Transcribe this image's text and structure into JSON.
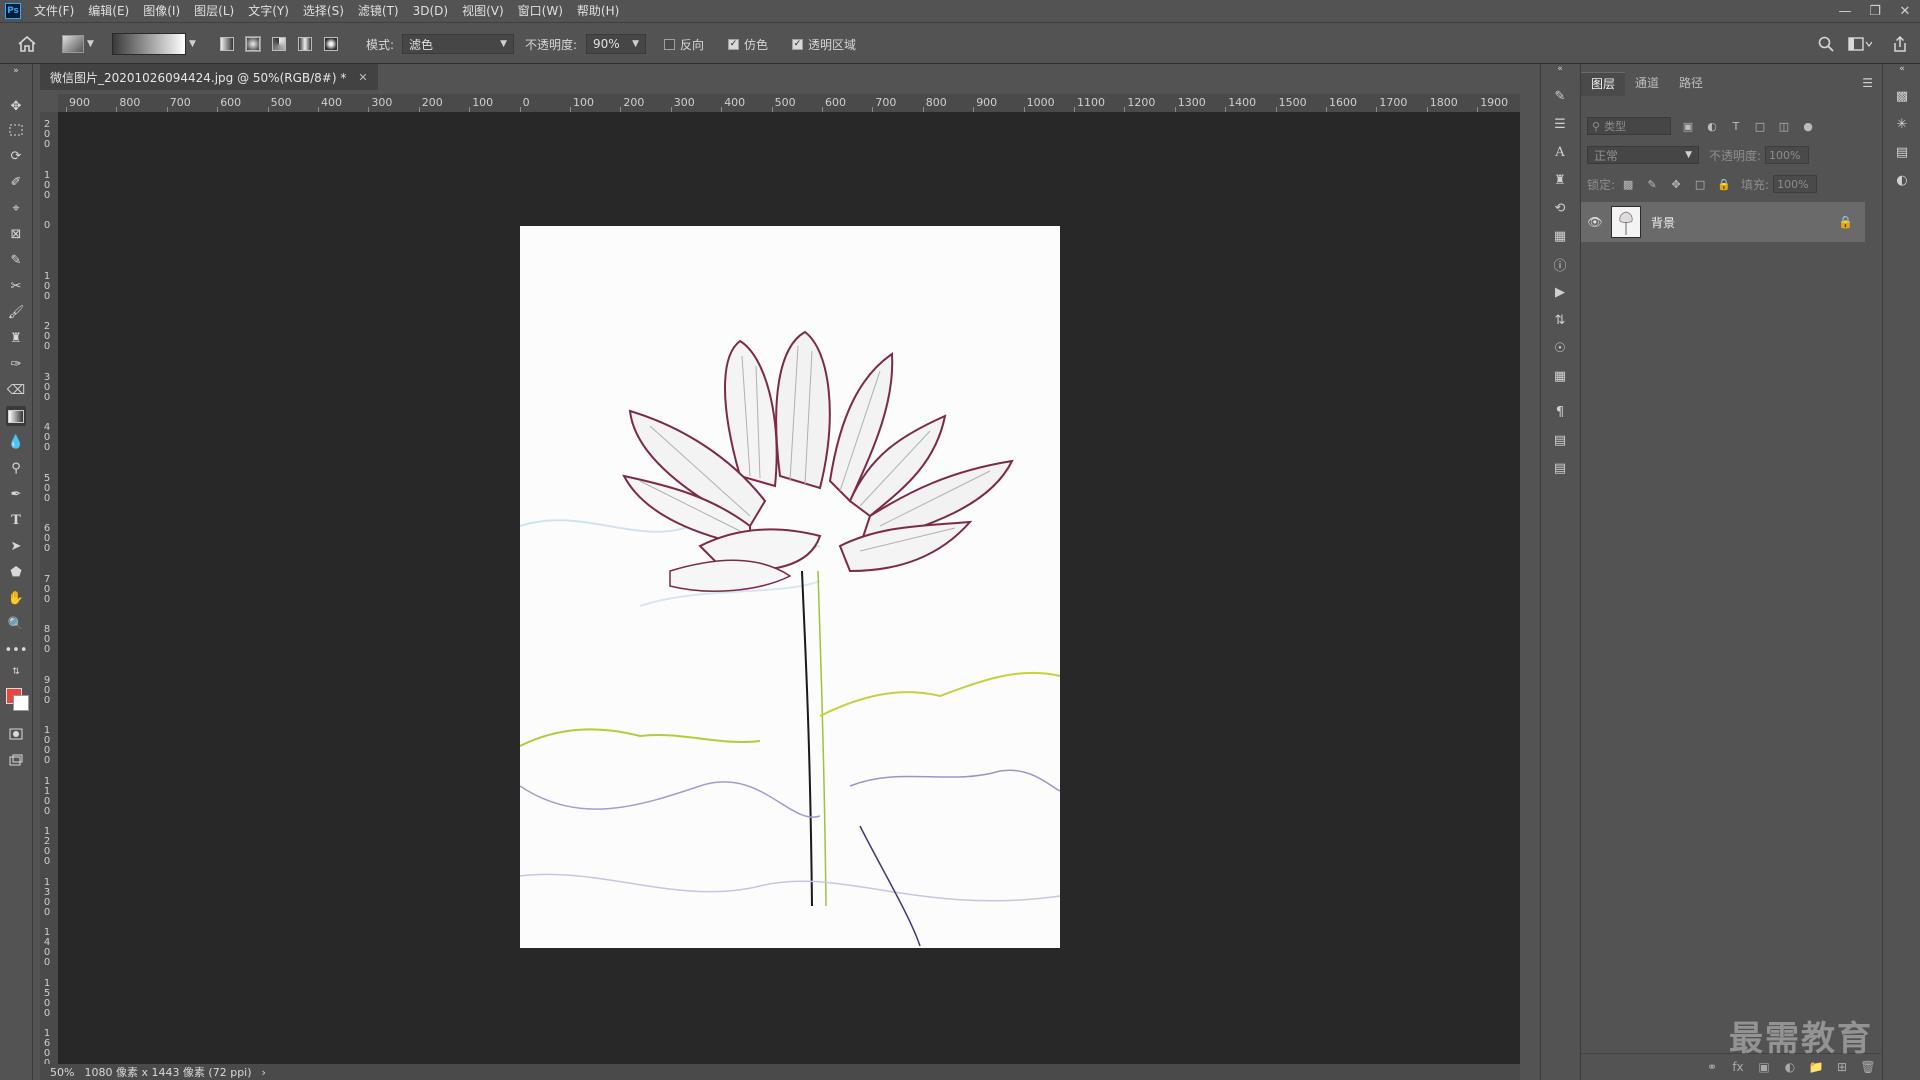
{
  "menu": {
    "logo": "Ps",
    "items": [
      "文件(F)",
      "编辑(E)",
      "图像(I)",
      "图层(L)",
      "文字(Y)",
      "选择(S)",
      "滤镜(T)",
      "3D(D)",
      "视图(V)",
      "窗口(W)",
      "帮助(H)"
    ]
  },
  "options": {
    "mode_label": "模式:",
    "mode_value": "滤色",
    "opacity_label": "不透明度:",
    "opacity_value": "90%",
    "reverse_label": "反向",
    "dither_label": "仿色",
    "transparency_label": "透明区域",
    "reverse_checked": false,
    "dither_checked": true,
    "transparency_checked": true
  },
  "document": {
    "tab_title": "微信图片_20201026094424.jpg @ 50%(RGB/8#) *",
    "zoom": "50%",
    "info": "1080 像素 x 1443 像素 (72 ppi)"
  },
  "ruler": {
    "top_labels": [
      "900",
      "800",
      "700",
      "600",
      "500",
      "400",
      "300",
      "200",
      "100",
      "0",
      "100",
      "200",
      "300",
      "400",
      "500",
      "600",
      "700",
      "800",
      "900",
      "1000",
      "1100",
      "1200",
      "1300",
      "1400",
      "1500",
      "1600",
      "1700",
      "1800",
      "1900"
    ],
    "left_labels": [
      "200",
      "100",
      "0",
      "100",
      "200",
      "300",
      "400",
      "500",
      "600",
      "700",
      "800",
      "900",
      "1000",
      "1100",
      "1200",
      "1300",
      "1400",
      "1500",
      "1600"
    ]
  },
  "colors": {
    "foreground": "#e8453c",
    "background": "#ffffff",
    "canvas_bg": "#282828",
    "ui_bg": "#535353"
  },
  "layers_panel": {
    "tabs": [
      "图层",
      "通道",
      "路径"
    ],
    "filter_placeholder": "类型",
    "blend_mode": "正常",
    "opacity_label": "不透明度:",
    "opacity_value": "100%",
    "lock_label": "锁定:",
    "fill_label": "填充:",
    "fill_value": "100%",
    "layers": [
      {
        "name": "背景",
        "visible": true,
        "locked": true
      }
    ]
  },
  "watermark": "最需教育"
}
